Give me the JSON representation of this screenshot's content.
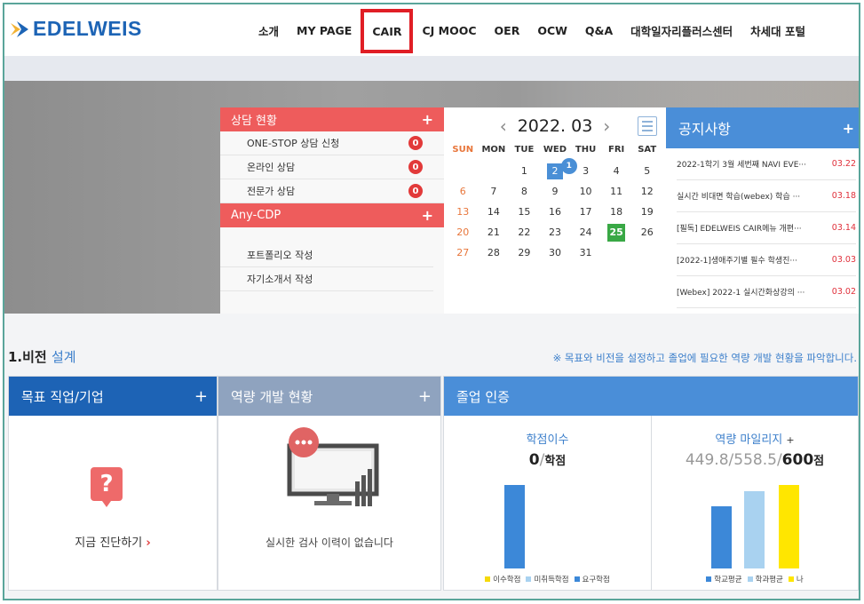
{
  "header": {
    "logo": "EDELWEIS",
    "nav": [
      "소개",
      "MY PAGE",
      "CAIR",
      "CJ MOOC",
      "OER",
      "OCW",
      "Q&A",
      "대학일자리플러스센터",
      "차세대 포털"
    ],
    "active": "CAIR"
  },
  "consult": {
    "title": "상담 현황",
    "items": [
      {
        "label": "ONE-STOP 상담 신청",
        "count": "0"
      },
      {
        "label": "온라인 상담",
        "count": "0"
      },
      {
        "label": "전문가 상담",
        "count": "0"
      }
    ]
  },
  "cdp": {
    "title": "Any-CDP",
    "items": [
      "포트폴리오 작성",
      "자기소개서 작성"
    ]
  },
  "calendar": {
    "month": "2022. 03",
    "weekdays": [
      "SUN",
      "MON",
      "TUE",
      "WED",
      "THU",
      "FRI",
      "SAT"
    ],
    "days": [
      "",
      "",
      "1",
      "2",
      "3",
      "4",
      "5",
      "6",
      "7",
      "8",
      "9",
      "10",
      "11",
      "12",
      "13",
      "14",
      "15",
      "16",
      "17",
      "18",
      "19",
      "20",
      "21",
      "22",
      "23",
      "24",
      "25",
      "26",
      "27",
      "28",
      "29",
      "30",
      "31",
      "",
      ""
    ],
    "selected": "2",
    "selected_badge": "1",
    "today": "25"
  },
  "notice": {
    "title": "공지사항",
    "items": [
      {
        "title": "2022-1학기 3월 세번째 NAVI EVE···",
        "date": "03.22"
      },
      {
        "title": "실시간 비대면 학습(webex) 학습 ···",
        "date": "03.18"
      },
      {
        "title": "[필독] EDELWEIS CAIR메뉴 개편···",
        "date": "03.14"
      },
      {
        "title": "[2022-1]생애주기별 필수 학생진···",
        "date": "03.03"
      },
      {
        "title": "[Webex] 2022-1 실시간화상강의 ···",
        "date": "03.02"
      }
    ]
  },
  "section": {
    "title_prefix": "1.비전",
    "title_accent": "설계",
    "note": "※ 목표와 비전을 설정하고 졸업에 필요한 역량 개발 현황을 파악합니다."
  },
  "goal": {
    "title": "목표 직업/기업",
    "link": "지금 진단하기"
  },
  "competency": {
    "title": "역량 개발 현황",
    "message": "실시한 검사 이력이 없습니다"
  },
  "graduation": {
    "title": "졸업 인증",
    "credits": {
      "title": "학점이수",
      "value": "0",
      "sep": "/",
      "unit": "학점",
      "legend": [
        "이수학점",
        "미취득학점",
        "요구학점"
      ],
      "bars": [
        {
          "name": "이수학점",
          "value": 0,
          "color": "#f5d90a"
        },
        {
          "name": "미취득학점",
          "value": 0,
          "color": "#a9d2f0"
        },
        {
          "name": "요구학점",
          "value": 1,
          "color": "#3c88d8"
        }
      ]
    },
    "mileage": {
      "title": "역량 마일리지",
      "title_plus": "+",
      "school_avg": "449.8",
      "dept_avg": "558.5",
      "mine": "600",
      "unit": "점",
      "legend": [
        "학교평균",
        "학과평균",
        "나"
      ],
      "bars": [
        {
          "name": "학교평균",
          "value": 449.8,
          "color": "#3c88d8"
        },
        {
          "name": "학과평균",
          "value": 558.5,
          "color": "#a9d2f0"
        },
        {
          "name": "나",
          "value": 600,
          "color": "#ffe600"
        }
      ]
    }
  }
}
